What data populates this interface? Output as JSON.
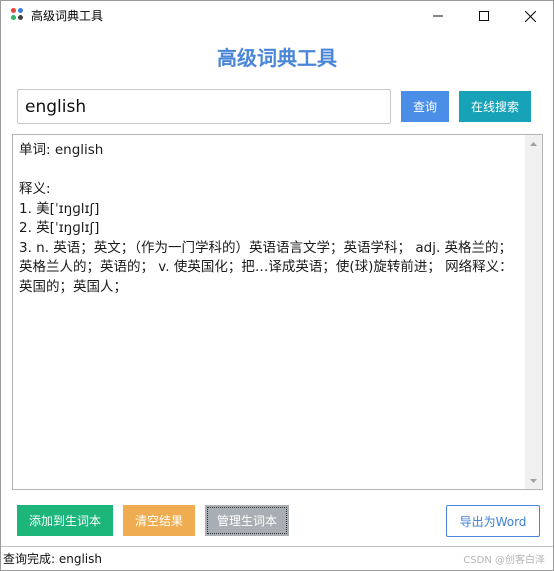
{
  "window": {
    "title": "高级词典工具",
    "icon": "app-dots-icon"
  },
  "header": {
    "title": "高级词典工具"
  },
  "search": {
    "value": "english",
    "query_label": "查询",
    "online_label": "在线搜索"
  },
  "result": {
    "text": "单词: english\n\n释义:\n1. 美[ˈɪŋɡlɪʃ]\n2. 英[ˈɪŋɡlɪʃ]\n3. n. 英语；英文；（作为一门学科的）英语语言文学；英语学科； adj. 英格兰的；英格兰人的；英语的； v. 使英国化；把…译成英语；使(球)旋转前进； 网络释义： 英国的；英国人；"
  },
  "actions": {
    "add_label": "添加到生词本",
    "clear_label": "清空结果",
    "manage_label": "管理生词本",
    "export_label": "导出为Word"
  },
  "status": {
    "text": "查询完成: english",
    "watermark": "CSDN @创客白泽"
  },
  "colors": {
    "header": "#4a86d8",
    "query": "#4a8ee8",
    "online": "#17a2b8",
    "add": "#1cb57a",
    "clear": "#f0ac50",
    "manage": "#a9aeb4",
    "export_border": "#4a86d8"
  }
}
